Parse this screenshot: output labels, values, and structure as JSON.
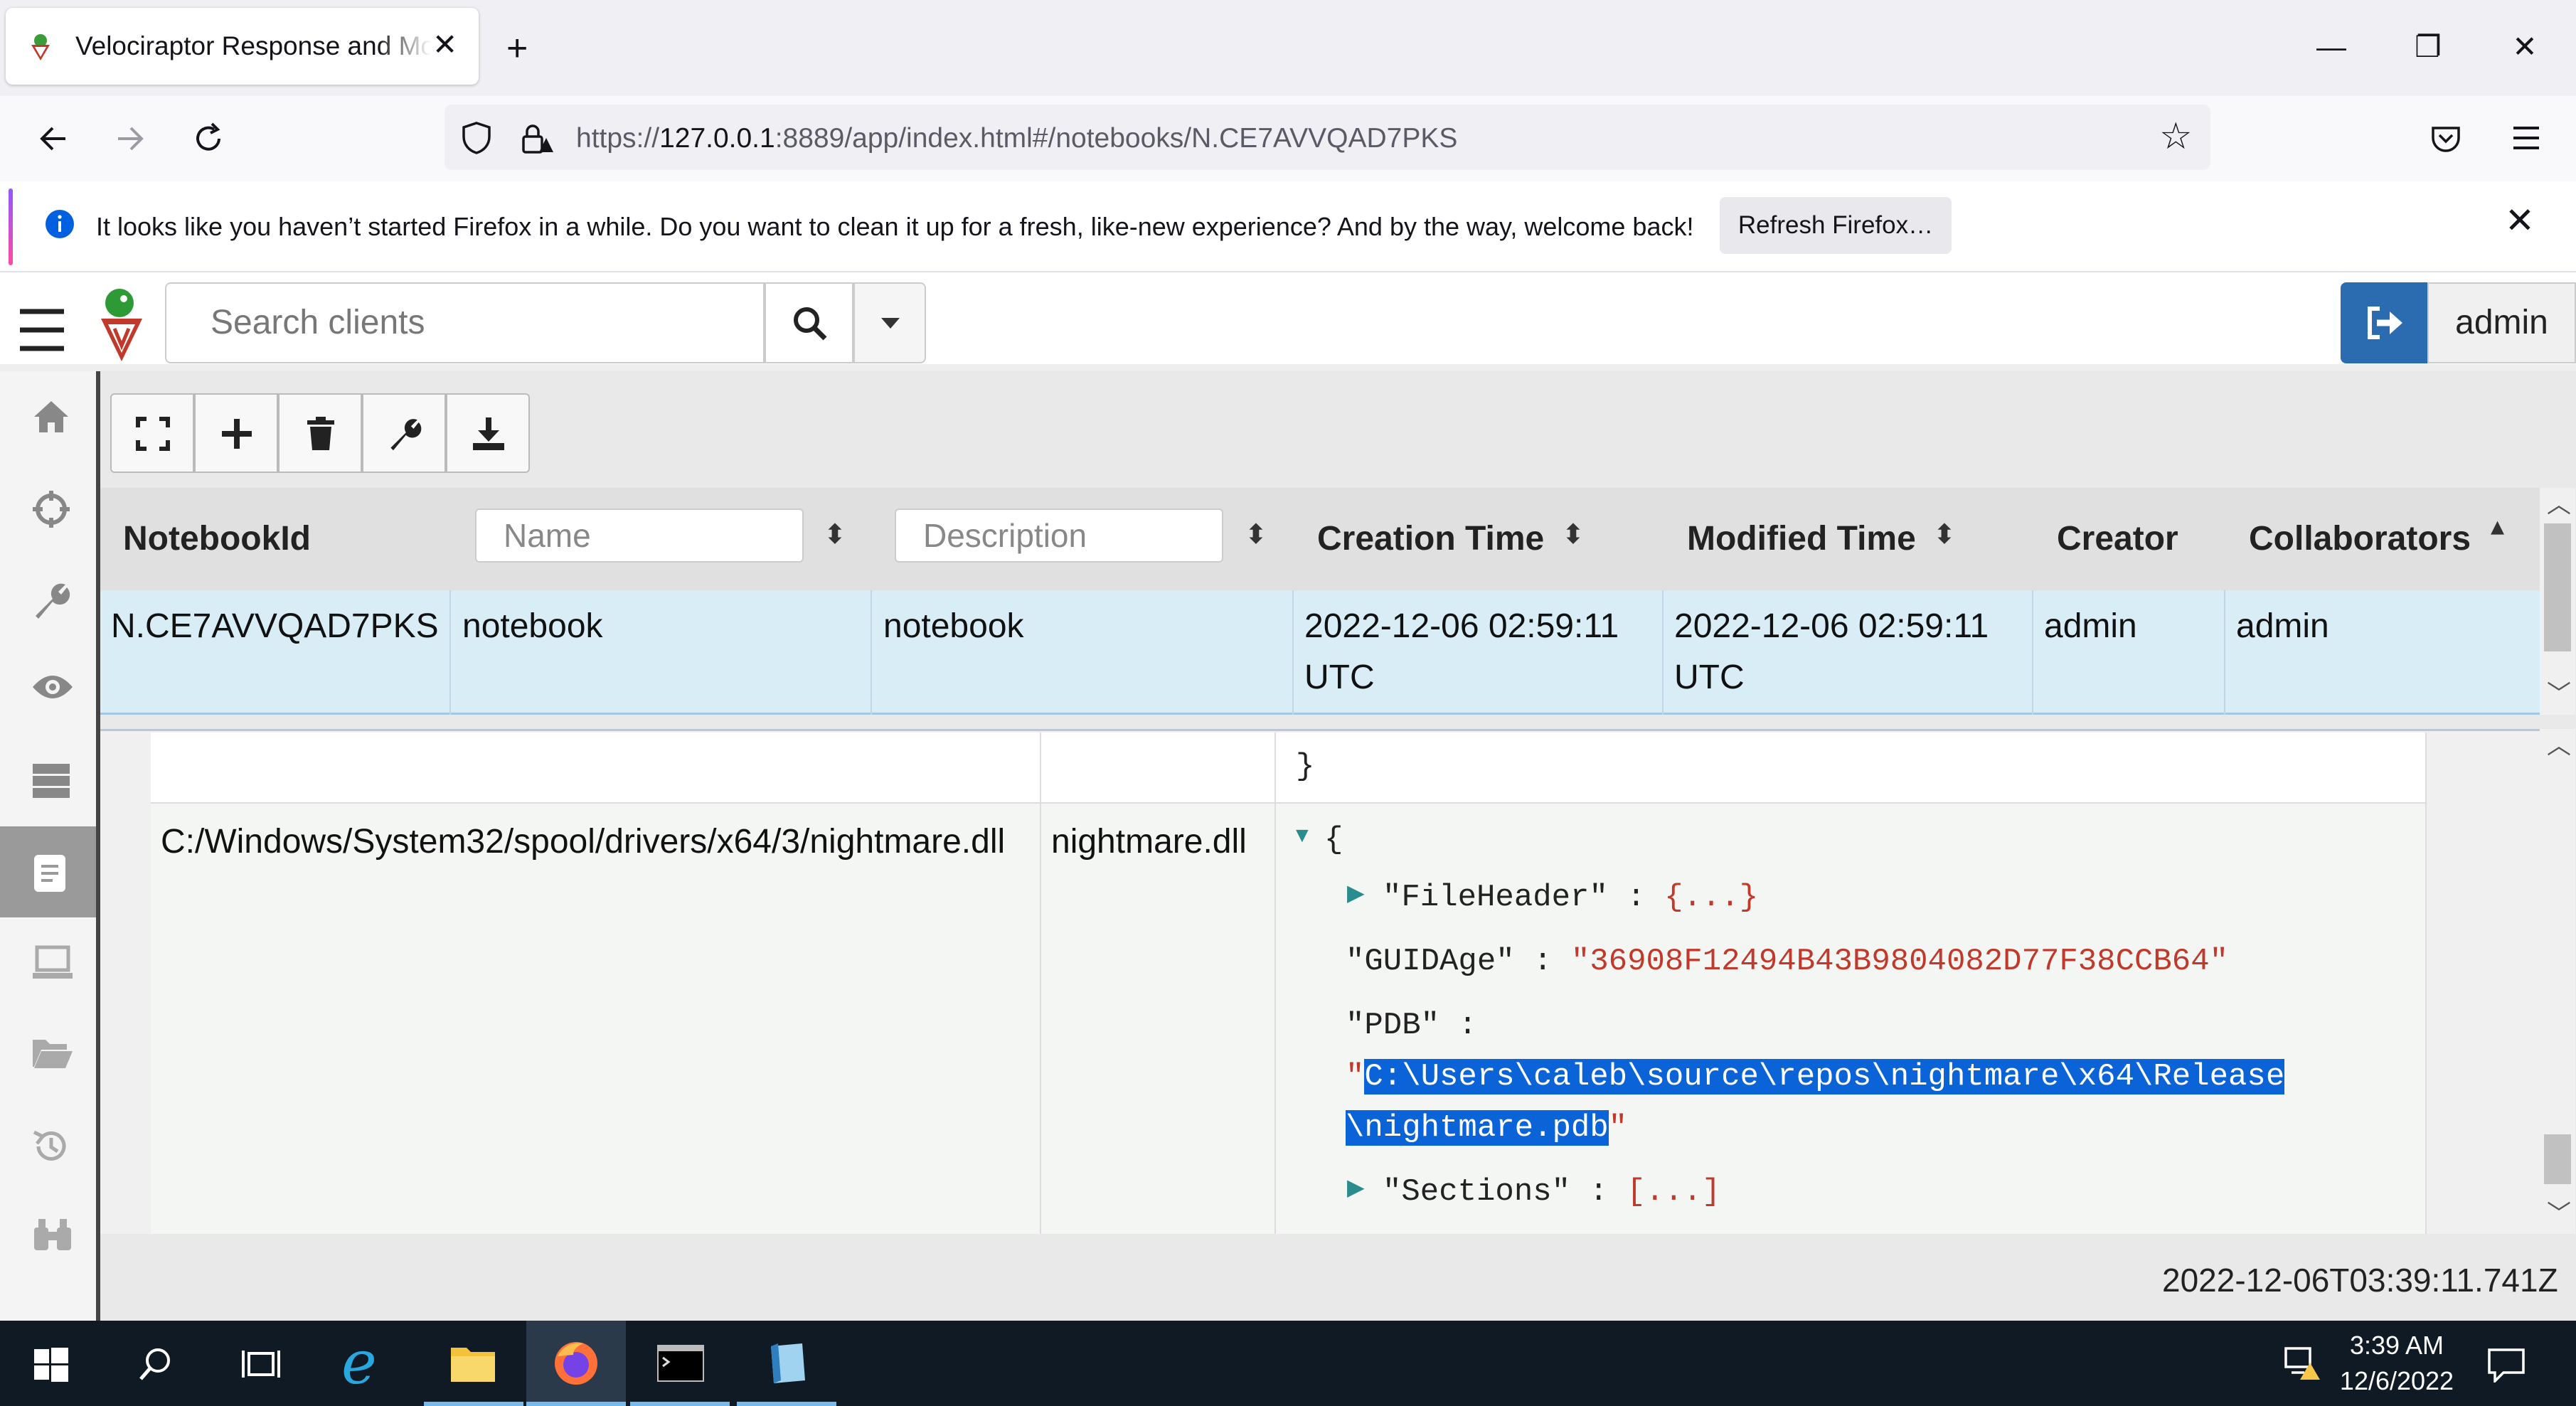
{
  "browser": {
    "tab_title": "Velociraptor Response and Mon",
    "url_prefix": "https://",
    "url_host": "127.0.0.1",
    "url_rest": ":8889/app/index.html#/notebooks/N.CE7AVVQAD7PKS",
    "info_message": "It looks like you haven’t started Firefox in a while. Do you want to clean it up for a fresh, like-new experience? And by the way, welcome back!",
    "refresh_button": "Refresh Firefox…"
  },
  "app": {
    "search_placeholder": "Search clients",
    "user": "admin"
  },
  "table": {
    "headers": {
      "notebook_id": "NotebookId",
      "name_placeholder": "Name",
      "description_placeholder": "Description",
      "creation_time": "Creation Time",
      "modified_time": "Modified Time",
      "creator": "Creator",
      "collaborators": "Collaborators"
    },
    "row": {
      "notebook_id": "N.CE7AVVQAD7PKS",
      "name": "notebook",
      "description": "notebook",
      "creation_time_1": "2022-12-06 02:59:11",
      "creation_time_2": "UTC",
      "modified_time_1": "2022-12-06 02:59:11",
      "modified_time_2": "UTC",
      "creator": "admin",
      "collaborators": "admin"
    }
  },
  "detail": {
    "closing_brace": "}",
    "path": "C:/Windows/System32/spool/drivers/x64/3/nightmare.dll",
    "filename": "nightmare.dll",
    "open_brace": "{",
    "file_header_key": "\"FileHeader\"",
    "collapsed_obj": "{...}",
    "guid_key": "\"GUIDAge\"",
    "guid_value": "\"36908F12494B43B9804082D77F38CCB64\"",
    "pdb_key": "\"PDB\"",
    "pdb_line1": "C:\\Users\\caleb\\source\\repos\\nightmare\\x64\\Release",
    "pdb_line2": "\\nightmare.pdb",
    "sections_key": "\"Sections\"",
    "collapsed_arr": "[...]"
  },
  "status_timestamp": "2022-12-06T03:39:11.741Z",
  "taskbar": {
    "time": "3:39 AM",
    "date": "12/6/2022"
  }
}
